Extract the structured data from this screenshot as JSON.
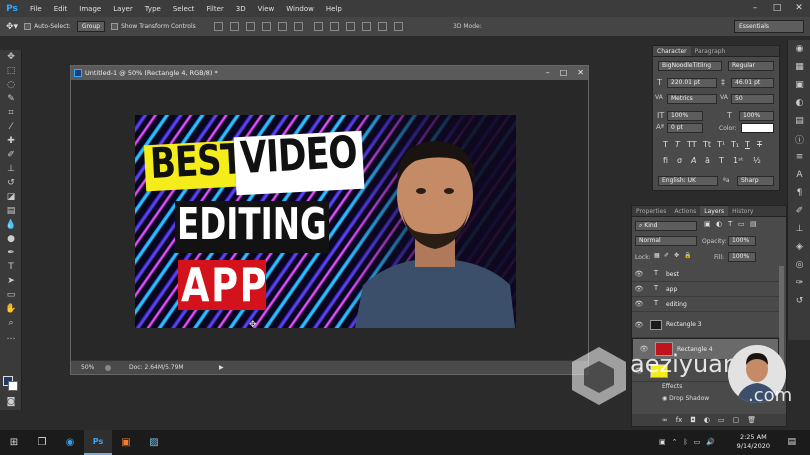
{
  "menubar": {
    "logo": "Ps",
    "items": [
      "File",
      "Edit",
      "Image",
      "Layer",
      "Type",
      "Select",
      "Filter",
      "3D",
      "View",
      "Window",
      "Help"
    ],
    "window_controls": [
      "–",
      "□",
      "✕"
    ]
  },
  "options": {
    "auto_select_label": "Auto-Select:",
    "auto_select_value": "Group",
    "transform_label": "Show Transform Controls",
    "mode_3d": "3D Mode:",
    "workspace": "Essentials"
  },
  "document": {
    "title": "Untitled-1 @ 50% (Rectangle 4, RGB/8) *",
    "zoom": "50%",
    "doc_size": "Doc: 2.64M/5.79M",
    "controls": [
      "–",
      "□",
      "✕"
    ]
  },
  "artwork": {
    "word1": "BEST",
    "word2": "VIDEO",
    "word3": "EDITING",
    "word4": "APP"
  },
  "character": {
    "tabs": [
      "Character",
      "Paragraph"
    ],
    "font_family": "BigNoodleTitling",
    "font_style": "Regular",
    "font_size": "220.01 pt",
    "leading": "46.01 pt",
    "kerning": "Metrics",
    "tracking": "50",
    "vscale": "100%",
    "hscale": "100%",
    "baseline": "0 pt",
    "color_label": "Color:",
    "language": "English: UK",
    "aa_label": "ªa",
    "aa_value": "Sharp"
  },
  "layers": {
    "tabs": [
      "Properties",
      "Actions",
      "Layers",
      "History"
    ],
    "kind": "Kind",
    "blend": "Normal",
    "opacity_label": "Opacity:",
    "opacity": "100%",
    "lock_label": "Lock:",
    "fill_label": "Fill:",
    "fill": "100%",
    "items": [
      {
        "name": "best",
        "type": "T"
      },
      {
        "name": "app",
        "type": "T"
      },
      {
        "name": "editing",
        "type": "T"
      },
      {
        "name": "Rectangle 3",
        "type": "rect"
      },
      {
        "name": "Rectangle 4",
        "type": "rect"
      }
    ],
    "effects": "Effects",
    "drop_shadow": "Drop Shadow"
  },
  "watermark": {
    "text1": "aeziyuan",
    "text2": ".com"
  },
  "taskbar": {
    "time": "2:25 AM",
    "date": "9/14/2020"
  },
  "colors": {
    "accent": "#31a8ff",
    "yellow": "#f4ec1b",
    "red": "#d3121b",
    "layer_swatch": "#c0141c"
  }
}
